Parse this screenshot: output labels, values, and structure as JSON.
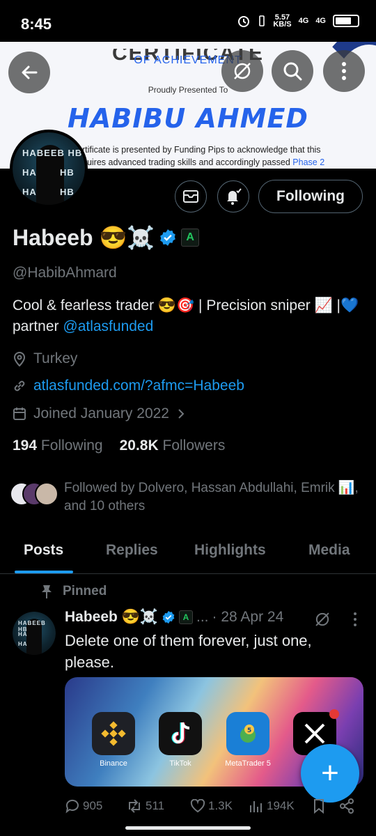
{
  "status_bar": {
    "time": "8:45",
    "net_speed_value": "5.57",
    "net_speed_unit": "KB/S",
    "sig1": "4G",
    "sig2": "4G"
  },
  "banner": {
    "title": "CERTIFICATE",
    "subtitle": "OF ACHIEVEMENT",
    "presented": "Proudly Presented To",
    "recipient": "HABIBU AHMED",
    "body_line1": "rtificate is presented by Funding Pips to acknowledge that this",
    "body_line2": "quires advanced trading skills and accordingly passed",
    "phase": "Phase 2"
  },
  "profile": {
    "avatar_text": [
      "HABEEB HB",
      "HA",
      "HB",
      "HA",
      "HB"
    ],
    "following_button": "Following",
    "display_name": "Habeeb 😎☠️",
    "handle": "@HabibAhmard",
    "bio_text": "Cool & fearless trader 😎🎯 | Precision sniper 📈 |💙 partner ",
    "bio_link": "@atlasfunded",
    "location": "Turkey",
    "website": "atlasfunded.com/?afmc=Habeeb",
    "joined": "Joined January 2022",
    "following_count": "194",
    "following_label": "Following",
    "followers_count": "20.8K",
    "followers_label": "Followers",
    "followed_by": "Followed by Dolvero, Hassan Abdullahi, Emrik 📊, and 10 others"
  },
  "tabs": [
    "Posts",
    "Replies",
    "Highlights",
    "Media"
  ],
  "pinned_post": {
    "pinned_label": "Pinned",
    "author": "Habeeb 😎☠️",
    "affiliate_badge": "A",
    "ellipsis": "...",
    "date": "· 28 Apr 24",
    "text": "Delete one of them forever, just one, please.",
    "apps": [
      "Binance",
      "TikTok",
      "MetaTrader 5",
      "X"
    ],
    "replies": "905",
    "reposts": "511",
    "likes": "1.3K",
    "views": "194K"
  },
  "fab_label": "+",
  "colors": {
    "accent": "#1d9bf0",
    "background": "#000000",
    "muted": "#71767b",
    "text": "#e7e9ea"
  },
  "icons": [
    "back-arrow-icon",
    "no-notify-icon",
    "search-icon",
    "more-vertical-icon",
    "mail-icon",
    "bell-check-icon",
    "verified-icon",
    "location-icon",
    "link-icon",
    "calendar-icon",
    "pin-icon",
    "reply-icon",
    "repost-icon",
    "like-icon",
    "views-icon",
    "bookmark-icon",
    "share-icon"
  ]
}
